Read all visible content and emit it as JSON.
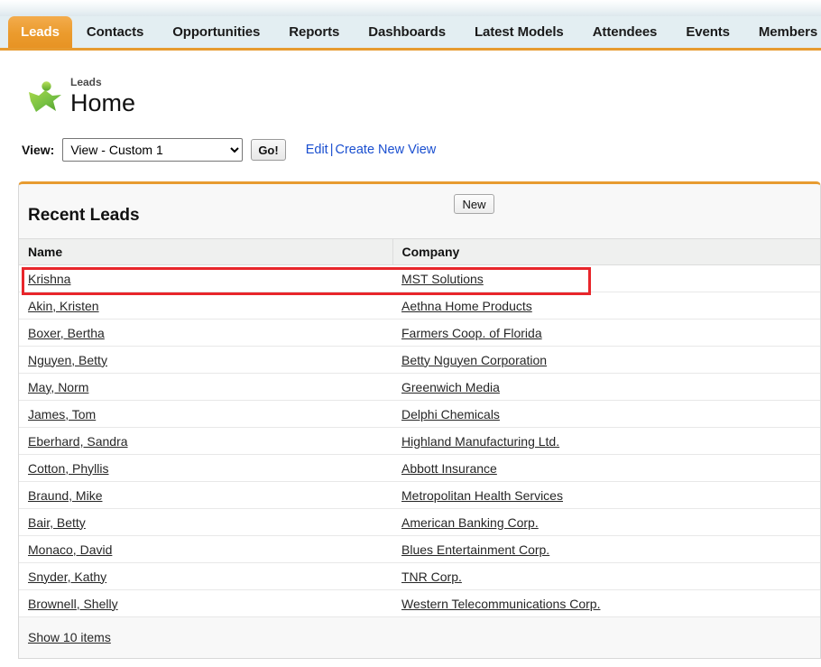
{
  "tabs": [
    {
      "label": "Leads",
      "active": true
    },
    {
      "label": "Contacts",
      "active": false
    },
    {
      "label": "Opportunities",
      "active": false
    },
    {
      "label": "Reports",
      "active": false
    },
    {
      "label": "Dashboards",
      "active": false
    },
    {
      "label": "Latest Models",
      "active": false
    },
    {
      "label": "Attendees",
      "active": false
    },
    {
      "label": "Events",
      "active": false
    },
    {
      "label": "Members",
      "active": false
    }
  ],
  "header": {
    "kicker": "Leads",
    "title": "Home",
    "icon": "lead-star-person-icon"
  },
  "viewbar": {
    "label": "View:",
    "selected_view": "View - Custom 1",
    "options": [
      "View - Custom 1"
    ],
    "go_label": "Go!",
    "edit_label": "Edit",
    "separator": "|",
    "create_label": "Create New View"
  },
  "panel": {
    "title": "Recent Leads",
    "new_label": "New",
    "accent_color": "#e79b30",
    "columns": [
      "Name",
      "Company"
    ],
    "rows": [
      {
        "name": "Krishna",
        "company": "MST Solutions",
        "highlighted": true
      },
      {
        "name": "Akin, Kristen",
        "company": "Aethna Home Products",
        "highlighted": false
      },
      {
        "name": "Boxer, Bertha",
        "company": "Farmers Coop. of Florida",
        "highlighted": false
      },
      {
        "name": "Nguyen, Betty",
        "company": "Betty Nguyen Corporation",
        "highlighted": false
      },
      {
        "name": "May, Norm",
        "company": "Greenwich Media",
        "highlighted": false
      },
      {
        "name": "James, Tom",
        "company": "Delphi Chemicals",
        "highlighted": false
      },
      {
        "name": "Eberhard, Sandra",
        "company": "Highland Manufacturing Ltd.",
        "highlighted": false
      },
      {
        "name": "Cotton, Phyllis",
        "company": "Abbott Insurance",
        "highlighted": false
      },
      {
        "name": "Braund, Mike",
        "company": "Metropolitan Health Services",
        "highlighted": false
      },
      {
        "name": "Bair, Betty",
        "company": "American Banking Corp.",
        "highlighted": false
      },
      {
        "name": "Monaco, David",
        "company": "Blues Entertainment Corp.",
        "highlighted": false
      },
      {
        "name": "Snyder, Kathy",
        "company": "TNR Corp.",
        "highlighted": false
      },
      {
        "name": "Brownell, Shelly",
        "company": "Western Telecommunications Corp.",
        "highlighted": false
      }
    ],
    "footer_link": "Show 10 items"
  },
  "annotation": {
    "color": "#e8262b",
    "target_row": "Krishna"
  }
}
